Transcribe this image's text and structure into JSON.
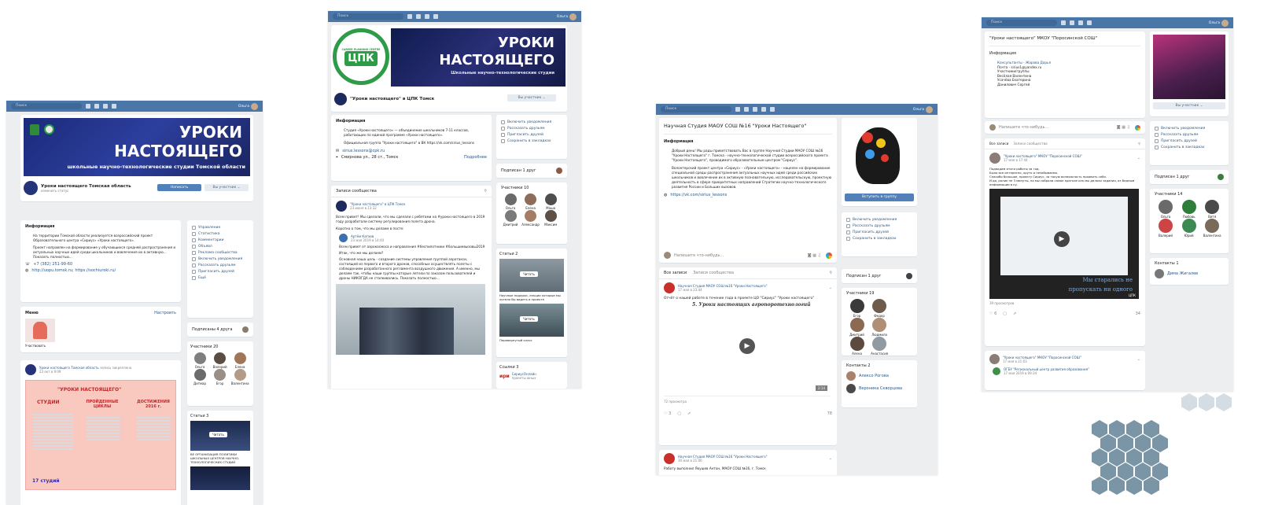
{
  "topbar": {
    "search": "Поиск",
    "user": "Ольга"
  },
  "s1": {
    "banner_line1": "УРОКИ",
    "banner_line2": "НАСТОЯЩЕГО",
    "banner_sub": "школьные научно-технологические студии Томской области",
    "title": "Уроки настоящего Томская область",
    "status": "изменить статус",
    "btn_write": "Написать",
    "btn_member": "Вы участник ⌄",
    "info_hd": "Информация",
    "info_text": "На территории Томской области реализуется всероссийский проект Образовательного центра «Сириус» «Уроки настоящего».",
    "info_text2": "Проект направлен на формирование у обучающихся средней распространения и актуальных научных идей среди школьников и вовлечения их в активную... Показать полностью...",
    "phone": "+7 (382) 251-99-60",
    "site": "http://uopu.tomsk.ru; https://sochiuroki.ru/",
    "menu_hd": "Меню",
    "menu_edit": "Настроить",
    "menu_item": "Участвовать",
    "post_author": "Уроки настоящего Томская область",
    "post_fix": "запись закреплена",
    "post_date": "23 окт в 9:09",
    "poster_title": "\"УРОКИ НАСТОЯЩЕГО\"",
    "poster_col1": "СТУДИИ",
    "poster_col2": "ПРОЙДЕННЫЕ ЦИКЛЫ",
    "poster_col3": "ДОСТИЖЕНИЯ 2016 г.",
    "poster_count": "17 студий",
    "side_menu": [
      "Управление",
      "Статистика",
      "Комментарии",
      "Объявл",
      "Реклама сообщества",
      "Включить уведомления",
      "Рассказать друзьям",
      "Пригласить друзей",
      "Ещё"
    ],
    "subs_hd": "Подписаны 4 друга",
    "members_hd": "Участники 20",
    "members": [
      "Ольга",
      "Валерий",
      "Елена",
      "Дитмар",
      "Егор",
      "Валентина"
    ],
    "articles_hd": "Статьи 3",
    "article_read": "Читать",
    "article_text": "ВЕ ОРГАНИЗАЦИЯ ПОЛИТИКИ ШКОЛЬНЫХ ЦЕНТРОВ НАУЧНО-ТЕХНОЛОГИЧЕСКИХ СТУДИЙ"
  },
  "s2": {
    "logo_text": "ЦПК",
    "logo_ring": "CAREER PLANNING CENTRE",
    "banner_line1": "УРОКИ",
    "banner_line2": "НАСТОЯЩЕГО",
    "banner_sub": "Школьные научно-технологические студии",
    "title": "\"Уроки настоящего\" в ЦПК Томск",
    "btn_member": "Вы участник ⌄",
    "info_hd": "Информация",
    "info_text": "Студия «Уроки настоящего» — объединение школьников 7-11 классов, работающих по единой программе «Уроки настоящего».",
    "info_text2": "Официальная группа \"Уроки настоящего\" в ВК https://vk.com/sirius_lessons",
    "email": "sirius.lessons@cpk.ru",
    "address": "Смирнова ул., 28 ст., Томск",
    "more": "Подробнее",
    "wall_hd": "Записи сообщества",
    "post_author": "\"Уроки настоящего\" в ЦПК Томск",
    "post_date": "23 июня в 13:32",
    "post_text": "Всем привет! Мы сделали, что мы сделали с ребятами на #уроки настоящего в 2019 году разработали систему регулирования полета дрона.",
    "post_text2": "Коротко о том, что мы делаем в посте:",
    "repost_author": "Артём Катаев",
    "repost_date": "23 мая 2019 в 14:40",
    "repost_text": "Всем привет от аэрокосмоса и направления #беспилотники #большиевызовы2019",
    "repost_text2": "Итак, что же мы делаем?",
    "repost_text3": "Основная наша цель - создание системы управления группой аэротакси, состоящей из первого и второго дронов, способных осуществлять полеты с соблюдением разработанного регламента воздушного движения. А именно, мы делаем так, чтобы наши группы которые летели по заказам пользователей и дроны НИКОГДА не сталкивались. Показать полностью...",
    "side_menu": [
      "Включить уведомления",
      "Рассказать друзьям",
      "Пригласить друзей",
      "Сохранить в закладках"
    ],
    "subs_hd": "Подписан 1 друг",
    "members_hd": "Участники 10",
    "members": [
      "Ольга",
      "Елена",
      "Маша",
      "Дмитрий",
      "Александр",
      "Максим"
    ],
    "articles_hd": "Статьи 2",
    "article_read": "Читать",
    "article1": "Научные подарки, лекции которые мы хотели бы видеть в проекте",
    "article2": "Перевернутый класс",
    "links_hd": "Ссылки 3",
    "link_name": "СириусОнлайн",
    "link_sub": "проекты юных"
  },
  "s3": {
    "title": "Научная Студия МАОУ СОШ №16 \"Уроки Настоящего\"",
    "info_hd": "Информация",
    "info_text": "Добрый день! Мы рады приветствовать Вас в группе Научной Студии МАОУ СОШ №16 \"Уроки Настоящего\" г. Томска - научно-технологической студии всероссийского проекта \"Уроки Настоящего\", проводимого образовательным центром \"Сириус\".",
    "info_text2": "Волонтерский проект центра «Сириус» - «Уроки настоящего» - нацелен на формирование специальной среды распространения актуальных научных идей среди российских школьников и вовлечение их в активную познавательную, исследовательскую, проектную деятельность в сфере приоритетных направлений Стратегии научно-технологического развития России и Больших вызовов.",
    "site": "https://vk.com/sirius_lessons",
    "join": "Вступить в группу",
    "side_menu": [
      "Включить уведомления",
      "Рассказать друзьям",
      "Пригласить друзей",
      "Сохранить в закладках"
    ],
    "composer": "Напишите что-нибудь...",
    "tab1": "Все записи",
    "tab2": "Записи сообщества",
    "post_author": "Научная Студия МАОУ СОШ №16 \"Уроки Настоящего\"",
    "post_date": "17 мая в 23:44",
    "post_text": "Отчёт о нашей работе в течение года в проекте ЦО \"Сириус\" \"Уроки настоящего\"",
    "video_title": "5. Уроки настоящих агропоротехнологий",
    "video_time": "2:14",
    "views": "72 просмотра",
    "likes": "3",
    "share_count": "78",
    "post2_author": "Научная Студия МАОУ СОШ №16 \"Уроки Настоящего\"",
    "post2_date": "30 мая в 21:06",
    "post2_text": "Работу выполнил Якушев Антон, МАОУ СОШ №16, г. Томск",
    "subs_hd": "Подписан 1 друг",
    "members_hd": "Участники 19",
    "members": [
      "Егор",
      "Федор",
      "Дмитрий",
      "Людмила",
      "Алена",
      "Анастасия"
    ],
    "contacts_hd": "Контакты 2",
    "contacts": [
      "Алексо Рогова",
      "Вероника Скворцова"
    ]
  },
  "s4": {
    "title": "\"Уроки настоящего\" МКОУ \"Поросинской СОШ\"",
    "info_hd": "Информация",
    "info_lines": [
      "Консультанты - Жарова Дарья",
      "Почта - sirius1@yandex.ru",
      "Участники/группы",
      "Весёлая Валентина",
      "Усачёва Екатерина",
      "Данилович Сергей"
    ],
    "side_menu": [
      "Включить уведомления",
      "Рассказать друзьям",
      "Пригласить друзей",
      "Сохранить в закладках"
    ],
    "composer": "Напишите что-нибудь...",
    "tab1": "Все записи",
    "tab2": "Записи сообщества",
    "post_author": "\"Уроки настоящего\" МКОУ \"Поросинской СОШ\"",
    "post_date": "17 мая в 17:44",
    "post_text": "Подводим итоги работы за год.",
    "post_text2": "Было все интересно, круто и незабываемо.",
    "post_text3": "Спасибо большое, проекту Сириус, за такую возможность проявить себя.",
    "post_text4": "И да, ролик не 3 минуты, но мы собрали самое краткое как мы делали задания, из бедным информации в ку.",
    "video_caption1": "Мы старались не",
    "video_caption2": "пропускать ни одного",
    "brand": "ЦПК",
    "views": "39 просмотров",
    "likes": "6",
    "shares": "34",
    "post2_author": "\"Уроки настоящего\" МКОУ \"Поросинской СОШ\"",
    "post2_date": "17 мая в 21:03",
    "repost_author": "ОГБУ \"Региональный центр развития образования\"",
    "repost_date": "17 мая 2019 в 09:34",
    "subs_hd": "Подписан 1 друг",
    "members_hd": "Участники 14",
    "members": [
      "Ольга",
      "Любовь",
      "Витя",
      "Валерий",
      "Юрий",
      "Валентина"
    ],
    "contacts_hd": "Контакты 1",
    "contact": "Дима Жигалев",
    "btn_member": "Вы участник ⌄"
  },
  "colors": {
    "topbar": "#4a76a8",
    "bg": "#edeef0",
    "hex_dark": "#7a96a6",
    "hex_light": "#c9d3db"
  }
}
